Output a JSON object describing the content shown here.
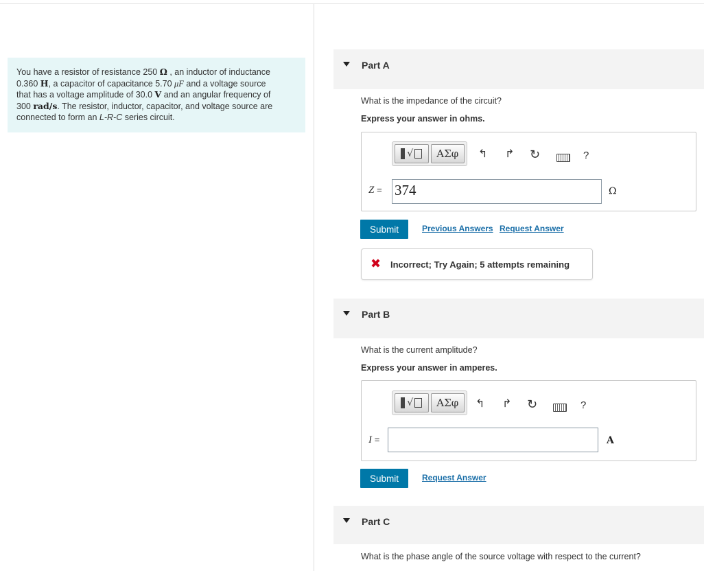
{
  "problem": {
    "line1_pre": "You have a resistor of resistance 250 ",
    "line1_unit": "Ω",
    "line1_post": " , an inductor of inductance",
    "line2_val": "0.360 ",
    "line2_unit": "H",
    "line2_mid": ", a capacitor of capacitance 5.70 ",
    "line2_unit2": "μF",
    "line2_post": " and a voltage source",
    "line3_pre": "that has a voltage amplitude of 30.0 ",
    "line3_unit": "V",
    "line3_post": " and an angular frequency of",
    "line4_val": "300 ",
    "line4_unit": "rad/s",
    "line4_post": ". The resistor, inductor, capacitor, and voltage source are",
    "line5_pre": "connected to form an ",
    "line5_circuit": "L-R-C",
    "line5_post": " series circuit."
  },
  "partA": {
    "title": "Part A",
    "question": "What is the impedance of the circuit?",
    "instruction": "Express your answer in ohms.",
    "toolbar": {
      "greek_label": "ΑΣφ",
      "help_label": "?"
    },
    "variable": "Z",
    "equals": "=",
    "answer_value": "374",
    "unit": "Ω",
    "submit_label": "Submit",
    "previous_answers_label": "Previous Answers",
    "request_answer_label": "Request Answer",
    "feedback_icon": "✖",
    "feedback_text": "Incorrect; Try Again; 5 attempts remaining"
  },
  "partB": {
    "title": "Part B",
    "question": "What is the current amplitude?",
    "instruction": "Express your answer in amperes.",
    "toolbar": {
      "greek_label": "ΑΣφ",
      "help_label": "?"
    },
    "variable": "I",
    "equals": "=",
    "answer_value": "",
    "unit": "A",
    "submit_label": "Submit",
    "request_answer_label": "Request Answer"
  },
  "partC": {
    "title": "Part C",
    "question": "What is the phase angle of the source voltage with respect to the current?"
  },
  "icons": {
    "undo": "↰",
    "redo": "↱",
    "reset": "↻"
  },
  "colors": {
    "accent": "#0078a8",
    "problem_bg": "#e6f6f7",
    "error": "#d0021b",
    "link": "#1b6fa8"
  }
}
